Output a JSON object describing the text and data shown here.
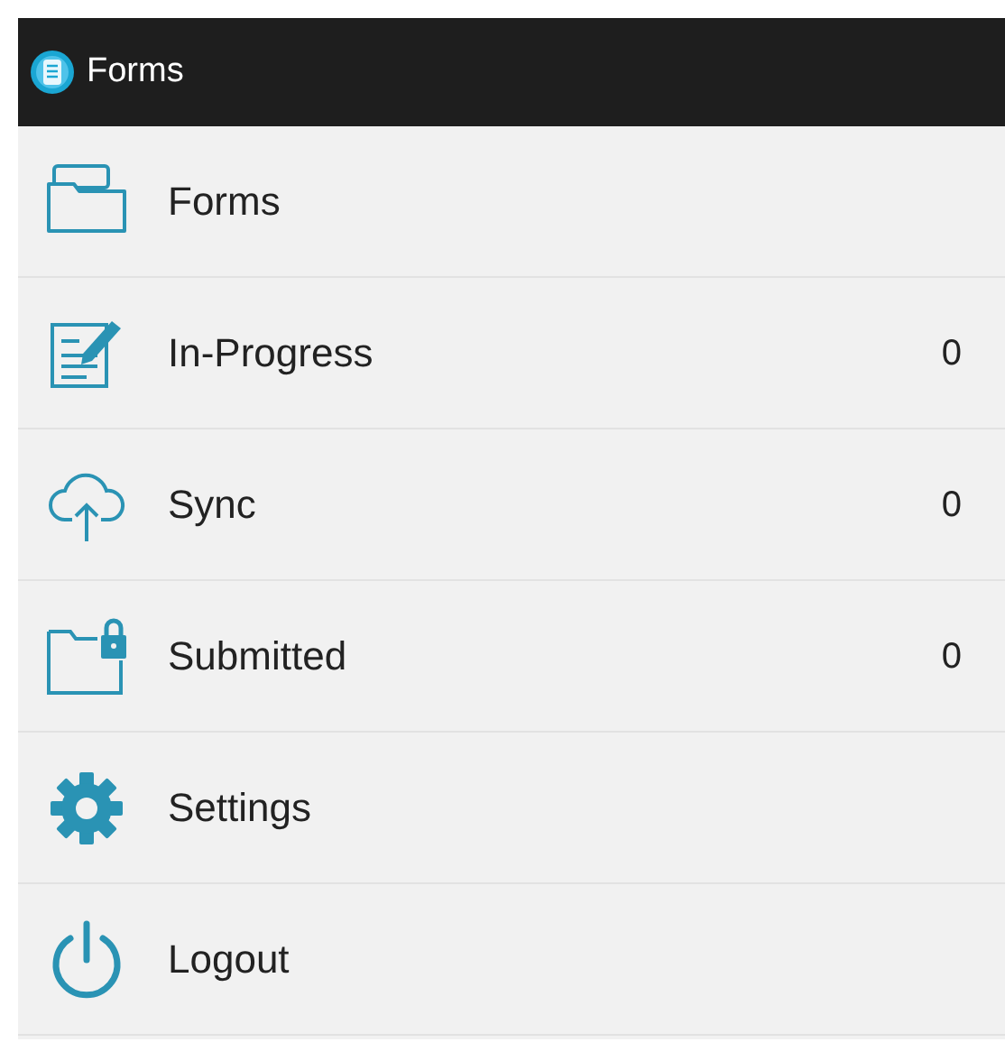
{
  "app_bar": {
    "title": "Forms"
  },
  "menu": [
    {
      "kind": "forms",
      "label": "Forms"
    },
    {
      "kind": "in-progress",
      "label": "In-Progress",
      "count": "0"
    },
    {
      "kind": "sync",
      "label": "Sync",
      "count": "0"
    },
    {
      "kind": "submitted",
      "label": "Submitted",
      "count": "0"
    },
    {
      "kind": "settings",
      "label": "Settings"
    },
    {
      "kind": "logout",
      "label": "Logout"
    }
  ]
}
